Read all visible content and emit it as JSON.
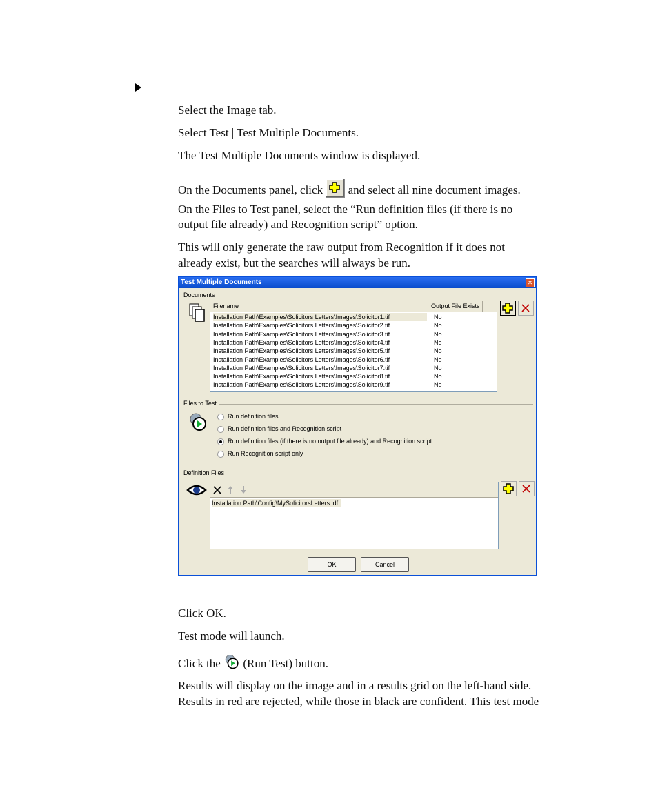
{
  "steps_before": [
    "Select the Image tab.",
    "Select Test | Test Multiple Documents.",
    "The Test Multiple Documents window is displayed.",
    "On the Documents panel, click",
    "and select all nine document images.",
    "On the Files to Test panel, select the “Run definition files (if there is no",
    "output file already) and Recognition script” option.",
    "This will only generate the raw output from Recognition if it does not",
    "already exist, but the searches will always be run."
  ],
  "dialog": {
    "title": "Test Multiple Documents",
    "documents_label": "Documents",
    "columns": [
      "Filename",
      "Output File Exists"
    ],
    "rows": [
      {
        "file": "Installation Path\\Examples\\Solicitors Letters\\Images\\Solicitor1.tif",
        "exists": "No"
      },
      {
        "file": "Installation Path\\Examples\\Solicitors Letters\\Images\\Solicitor2.tif",
        "exists": "No"
      },
      {
        "file": "Installation Path\\Examples\\Solicitors Letters\\Images\\Solicitor3.tif",
        "exists": "No"
      },
      {
        "file": "Installation Path\\Examples\\Solicitors Letters\\Images\\Solicitor4.tif",
        "exists": "No"
      },
      {
        "file": "Installation Path\\Examples\\Solicitors Letters\\Images\\Solicitor5.tif",
        "exists": "No"
      },
      {
        "file": "Installation Path\\Examples\\Solicitors Letters\\Images\\Solicitor6.tif",
        "exists": "No"
      },
      {
        "file": "Installation Path\\Examples\\Solicitors Letters\\Images\\Solicitor7.tif",
        "exists": "No"
      },
      {
        "file": "Installation Path\\Examples\\Solicitors Letters\\Images\\Solicitor8.tif",
        "exists": "No"
      },
      {
        "file": "Installation Path\\Examples\\Solicitors Letters\\Images\\Solicitor9.tif",
        "exists": "No"
      }
    ],
    "files_to_test_label": "Files to Test",
    "options": [
      "Run definition files",
      "Run definition files and Recognition script",
      "Run definition files (if there is no output file already) and Recognition script",
      "Run Recognition script only"
    ],
    "selected_option": 2,
    "definition_files_label": "Definition Files",
    "definition_files": [
      "Installation Path\\Config\\MySolicitorsLetters.idf"
    ],
    "ok": "OK",
    "cancel": "Cancel"
  },
  "steps_after": [
    "Click OK.",
    "Test mode will launch.",
    "Click the",
    "(Run Test) button.",
    "Results will display on the image and in a results grid on the left-hand side.",
    "Results in red are rejected, while those in black are confident. This test mode"
  ],
  "colors": {
    "titlebar": "#0a4ccc",
    "dialog_bg": "#ece9d8",
    "plus_icon": "#ffff00",
    "delete_icon": "#c00000"
  }
}
